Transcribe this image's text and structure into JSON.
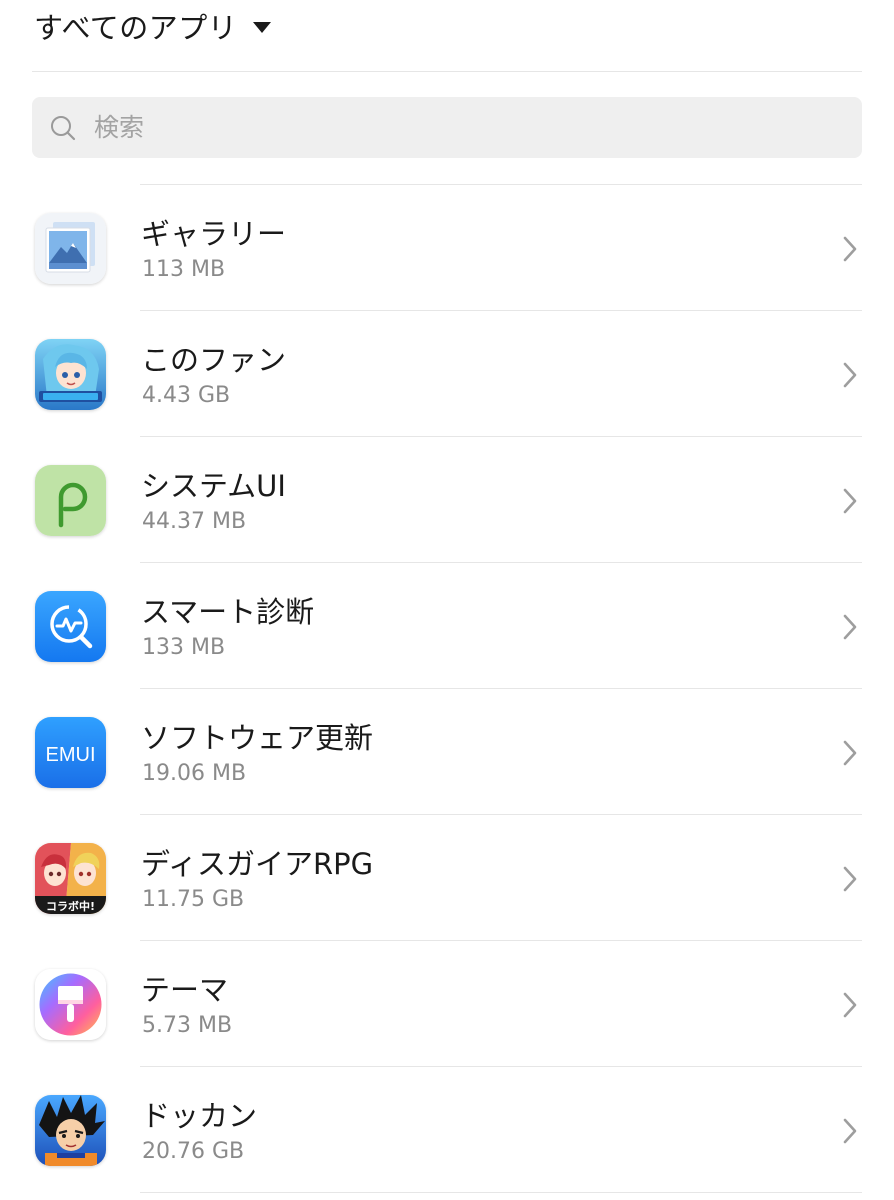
{
  "filter": {
    "label": "すべてのアプリ",
    "icon": "caret-down-icon"
  },
  "search": {
    "placeholder": "検索",
    "value": "",
    "icon": "search-icon"
  },
  "apps": [
    {
      "name": "ギャラリー",
      "size": "113 MB",
      "icon": "gallery-app-icon"
    },
    {
      "name": "このファン",
      "size": "4.43 GB",
      "icon": "konofan-app-icon"
    },
    {
      "name": "システムUI",
      "size": "44.37 MB",
      "icon": "system-ui-app-icon"
    },
    {
      "name": "スマート診断",
      "size": "133 MB",
      "icon": "smart-diagnosis-app-icon"
    },
    {
      "name": "ソフトウェア更新",
      "size": "19.06 MB",
      "icon": "software-update-app-icon",
      "icon_text": "EMUI"
    },
    {
      "name": "ディスガイアRPG",
      "size": "11.75 GB",
      "icon": "disgaea-rpg-app-icon",
      "icon_text": "コラボ中!"
    },
    {
      "name": "テーマ",
      "size": "5.73 MB",
      "icon": "themes-app-icon"
    },
    {
      "name": "ドッカン",
      "size": "20.76 GB",
      "icon": "dokkan-app-icon"
    }
  ],
  "colors": {
    "text_primary": "#1a1a1a",
    "text_secondary": "#8a8a8a",
    "divider": "#e6e6e6",
    "search_bg": "#efefef",
    "chevron": "#9e9e9e"
  }
}
